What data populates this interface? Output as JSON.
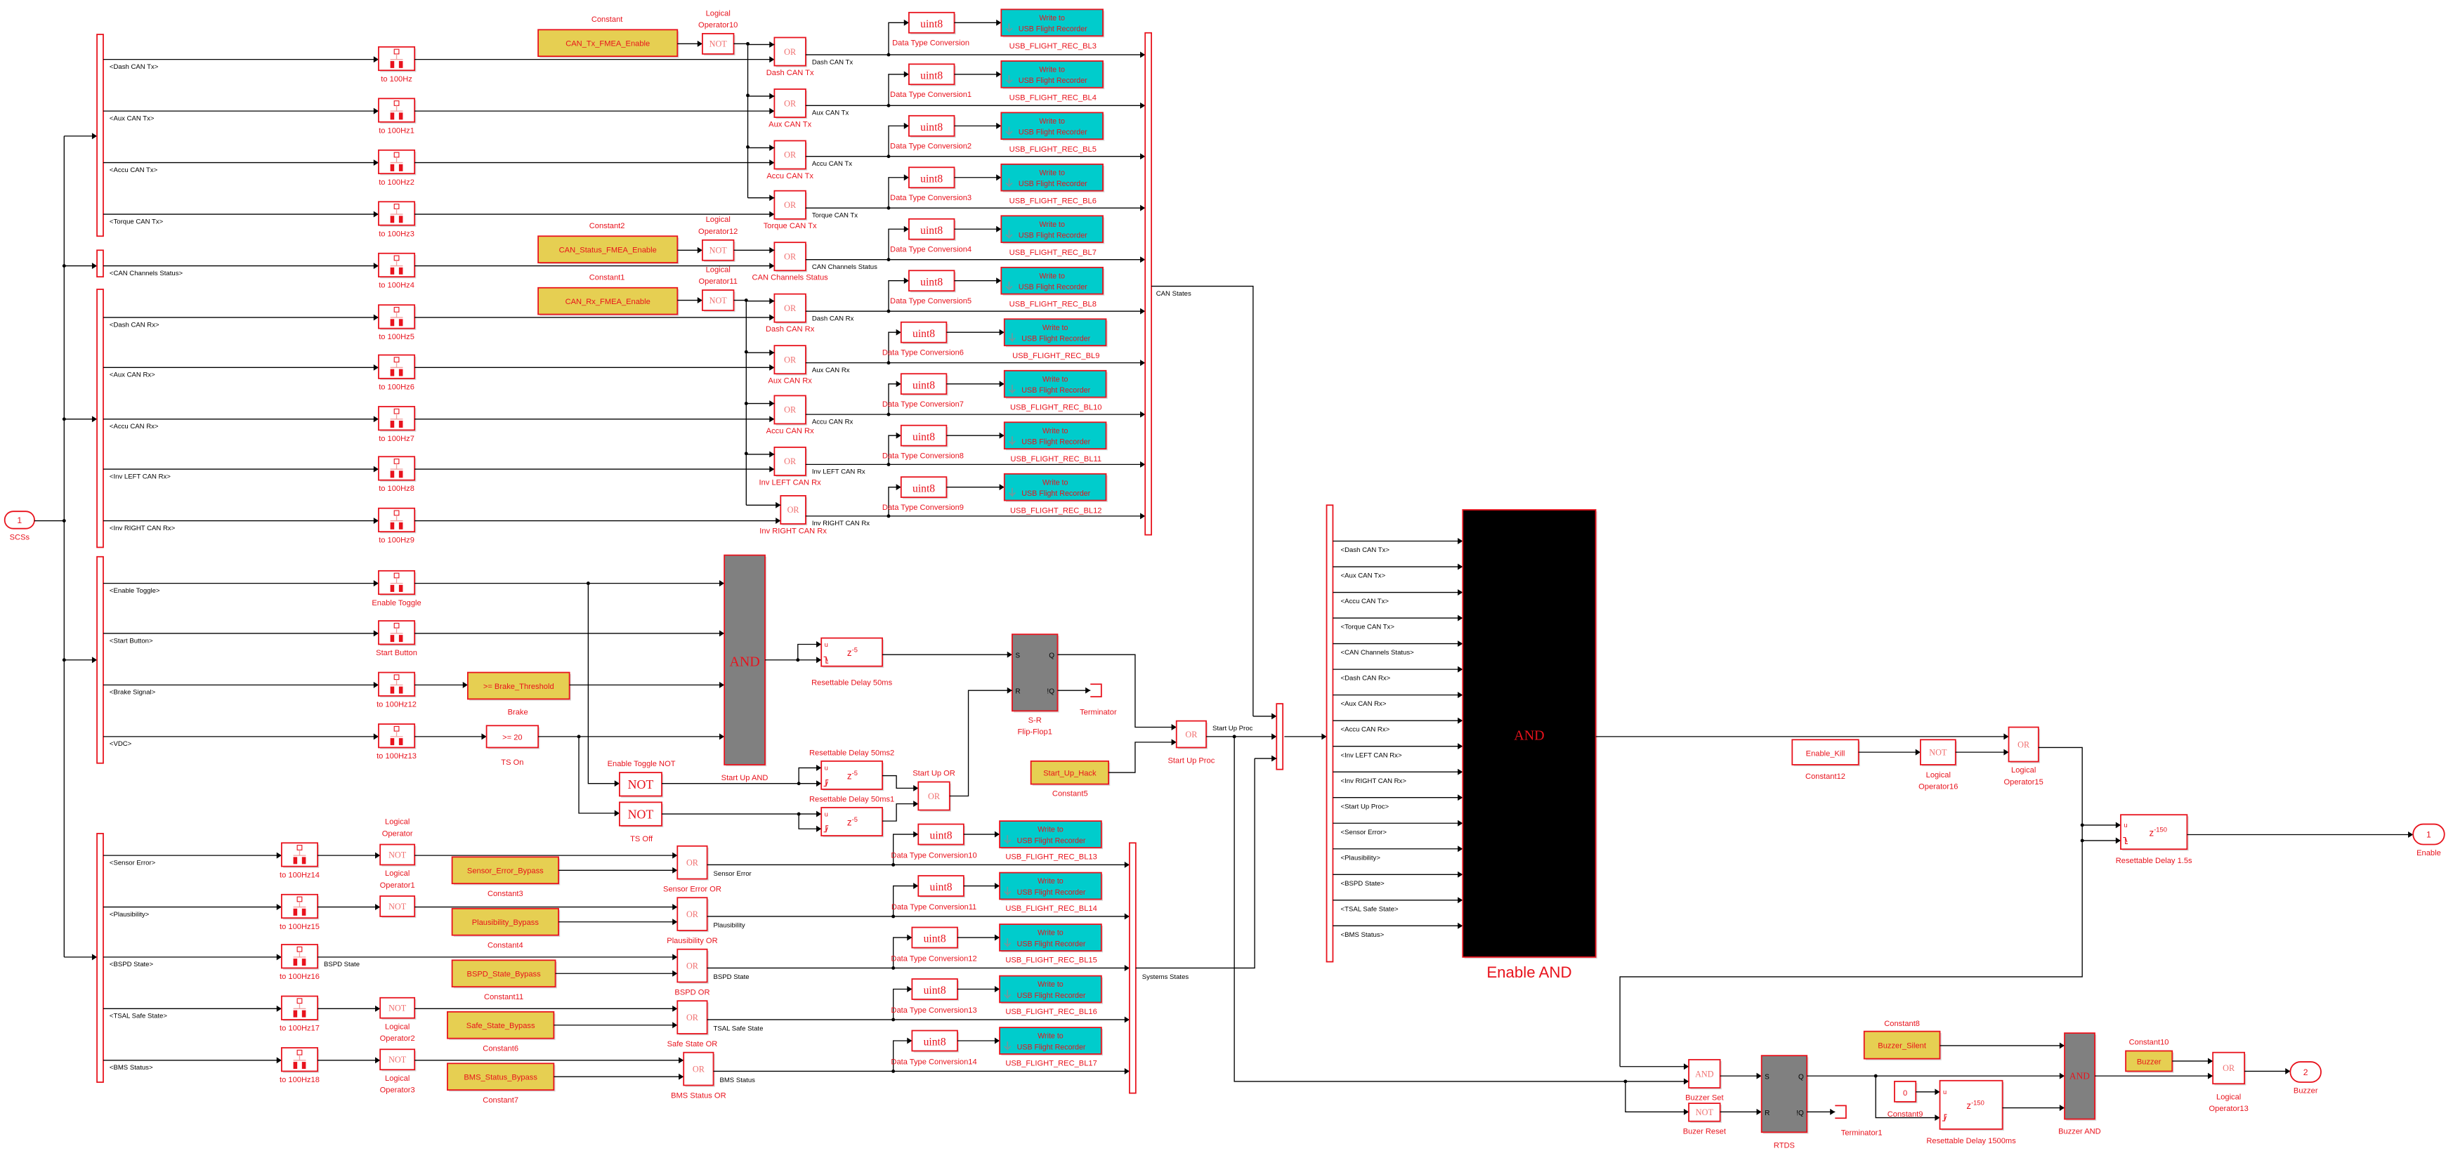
{
  "inport": {
    "number": "1",
    "name": "SCSs"
  },
  "outports": [
    {
      "number": "1",
      "name": "Enable"
    },
    {
      "number": "2",
      "name": "Buzzer"
    }
  ],
  "glyphs": {
    "or": "OR",
    "and": "AND",
    "not": "NOT",
    "uint8": "uint8",
    "recorder_line1": "Write to",
    "recorder_line2": "USB Flight Recorder",
    "delay_input": "u",
    "delay_base": "z",
    "sr_s": "S",
    "sr_r": "R",
    "sr_q": "Q",
    "sr_nq": "!Q"
  },
  "can": {
    "signals": [
      "<Dash CAN Tx>",
      "<Aux CAN Tx>",
      "<Accu CAN Tx>",
      "<Torque CAN Tx>",
      "<CAN Channels Status>",
      "<Dash CAN Rx>",
      "<Aux CAN Rx>",
      "<Accu CAN Rx>",
      "<Inv LEFT CAN Rx>",
      "<Inv RIGHT CAN Rx>"
    ],
    "rate_blocks": [
      "to 100Hz",
      "to 100Hz1",
      "to 100Hz2",
      "to 100Hz3",
      "to 100Hz4",
      "to 100Hz5",
      "to 100Hz6",
      "to 100Hz7",
      "to 100Hz8",
      "to 100Hz9"
    ],
    "fmea": [
      {
        "value": "CAN_Tx_FMEA_Enable",
        "name": "Constant",
        "not_name": "Logical Operator10"
      },
      {
        "value": "CAN_Status_FMEA_Enable",
        "name": "Constant2",
        "not_name": "Logical Operator12"
      },
      {
        "value": "CAN_Rx_FMEA_Enable",
        "name": "Constant1",
        "not_name": "Logical Operator11"
      }
    ],
    "or_blocks": [
      "Dash CAN Tx",
      "Aux CAN Tx",
      "Accu CAN Tx",
      "Torque CAN Tx",
      "CAN Channels Status",
      "Dash CAN Rx",
      "Aux CAN Rx",
      "Accu CAN Rx",
      "Inv LEFT CAN Rx",
      "Inv RIGHT CAN Rx"
    ],
    "out_signals": [
      "Dash CAN Tx",
      "Aux CAN Tx",
      "Accu CAN Tx",
      "Torque CAN Tx",
      "CAN Channels Status",
      "Dash CAN Rx",
      "Aux CAN Rx",
      "Accu CAN Rx",
      "Inv LEFT CAN Rx",
      "Inv RIGHT CAN Rx"
    ],
    "conversions": [
      "Data Type Conversion",
      "Data Type Conversion1",
      "Data Type Conversion2",
      "Data Type Conversion3",
      "Data Type Conversion4",
      "Data Type Conversion5",
      "Data Type Conversion6",
      "Data Type Conversion7",
      "Data Type Conversion8",
      "Data Type Conversion9"
    ],
    "recorders": [
      "USB_FLIGHT_REC_BL3",
      "USB_FLIGHT_REC_BL4",
      "USB_FLIGHT_REC_BL5",
      "USB_FLIGHT_REC_BL6",
      "USB_FLIGHT_REC_BL7",
      "USB_FLIGHT_REC_BL8",
      "USB_FLIGHT_REC_BL9",
      "USB_FLIGHT_REC_BL10",
      "USB_FLIGHT_REC_BL11",
      "USB_FLIGHT_REC_BL12"
    ],
    "bus_output": "CAN States"
  },
  "startup": {
    "signals": [
      "<Enable Toggle>",
      "<Start Button>",
      "<Brake Signal>",
      "<VDC>"
    ],
    "rate_blocks": [
      "Enable Toggle",
      "Start Button",
      "to 100Hz12",
      "to 100Hz13"
    ],
    "brake": {
      "value": ">= Brake_Threshold",
      "name": "Brake"
    },
    "ts_on": {
      "value": ">= 20",
      "name": "TS On"
    },
    "and_name": "Start Up AND",
    "enable_toggle_not": "Enable Toggle NOT",
    "ts_off": "TS Off",
    "delay_main": {
      "name": "Resettable Delay 50ms",
      "exponent": "-5"
    },
    "delay_2": {
      "name": "Resettable Delay 50ms2",
      "exponent": "-5"
    },
    "delay_1": {
      "name": "Resettable Delay 50ms1",
      "exponent": "-5"
    },
    "start_up_or": "Start Up OR",
    "flipflop": "S-R Flip-Flop1",
    "terminator": "Terminator",
    "hack": {
      "value": "Start_Up_Hack",
      "name": "Constant5"
    },
    "proc_or": "Start Up Proc",
    "proc_signal": "Start Up Proc"
  },
  "systems": {
    "signals": [
      "<Sensor Error>",
      "<Plausibility>",
      "<BSPD State>",
      "<TSAL Safe State>",
      "<BMS Status>"
    ],
    "rate_blocks": [
      "to 100Hz14",
      "to 100Hz15",
      "to 100Hz16",
      "to 100Hz17",
      "to 100Hz18"
    ],
    "not_names": [
      "Logical Operator",
      "Logical Operator1",
      "",
      "Logical Operator2",
      "Logical Operator3"
    ],
    "bspd_line": "BSPD State",
    "bypass": [
      {
        "value": "Sensor_Error_Bypass",
        "name": "Constant3"
      },
      {
        "value": "Plausibility_Bypass",
        "name": "Constant4"
      },
      {
        "value": "BSPD_State_Bypass",
        "name": "Constant11"
      },
      {
        "value": "Safe_State_Bypass",
        "name": "Constant6"
      },
      {
        "value": "BMS_Status_Bypass",
        "name": "Constant7"
      }
    ],
    "or_blocks": [
      "Sensor Error OR",
      "Plausibility OR",
      "BSPD OR",
      "Safe State OR",
      "BMS Status OR"
    ],
    "out_signals": [
      "Sensor Error",
      "Plausibility",
      "BSPD State",
      "TSAL Safe State",
      "BMS Status"
    ],
    "conversions": [
      "Data Type Conversion10",
      "Data Type Conversion11",
      "Data Type Conversion12",
      "Data Type Conversion13",
      "Data Type Conversion14"
    ],
    "recorders": [
      "USB_FLIGHT_REC_BL13",
      "USB_FLIGHT_REC_BL14",
      "USB_FLIGHT_REC_BL15",
      "USB_FLIGHT_REC_BL16",
      "USB_FLIGHT_REC_BL17"
    ],
    "bus_output": "Systems States"
  },
  "enable": {
    "bus_signals": [
      "<Dash CAN Tx>",
      "<Aux CAN Tx>",
      "<Accu CAN Tx>",
      "<Torque CAN Tx>",
      "<CAN Channels Status>",
      "<Dash CAN Rx>",
      "<Aux CAN Rx>",
      "<Accu CAN Rx>",
      "<Inv LEFT CAN Rx>",
      "<Inv RIGHT CAN Rx>",
      "<Start Up Proc>",
      "<Sensor Error>",
      "<Plausibility>",
      "<BSPD State>",
      "<TSAL Safe State>",
      "<BMS Status>"
    ],
    "and_name": "Enable AND",
    "kill": {
      "value": "Enable_Kill",
      "name": "Constant12"
    },
    "not_name": "Logical Operator16",
    "and2_name": "Logical Operator15",
    "delay": {
      "name": "Resettable Delay 1.5s",
      "exponent": "-150"
    }
  },
  "buzzer": {
    "set_name": "Buzzer Set",
    "reset_name": "Buzer Reset",
    "rtds": "RTDS",
    "terminator": "Terminator1",
    "silent": {
      "value": "Buzzer_Silent",
      "name": "Constant8"
    },
    "zero": {
      "value": "0",
      "name": "Constant9"
    },
    "delay": {
      "name": "Resettable Delay 1500ms",
      "exponent": "-150"
    },
    "and_name": "Buzzer AND",
    "buzzer_const": {
      "value": "Buzzer",
      "name": "Constant10"
    },
    "or_name": "Logical Operator13"
  },
  "colors": {
    "block_border": "#e8121c",
    "label": "#e8121c",
    "constant_fill": "#e6cf52",
    "recorder_fill": "#00cccc",
    "gray_block": "#808080",
    "black_block": "#000000",
    "line": "#000000"
  }
}
